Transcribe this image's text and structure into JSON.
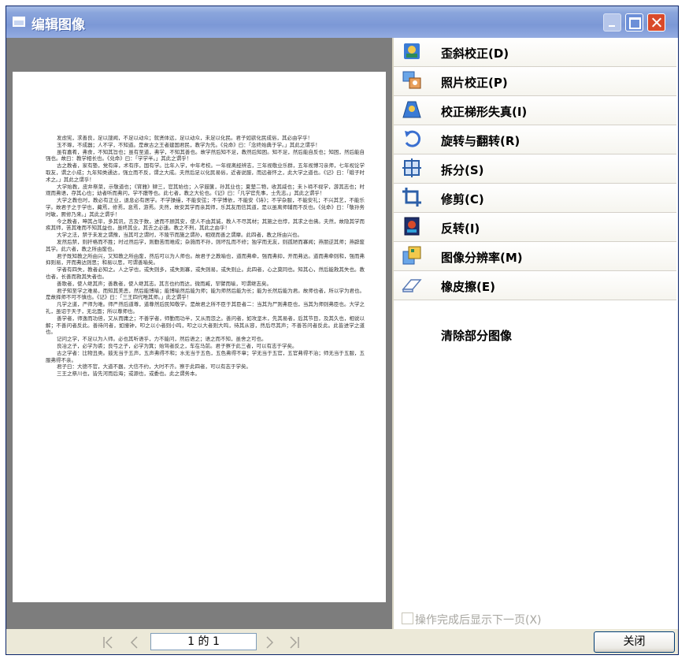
{
  "window": {
    "title": "编辑图像"
  },
  "document_text": [
    "发虑宪，求善良，足以謏闻，不足以动众；就贤体远，足以动众，未足以化民。君子如欲化民成俗，其必由学乎！",
    "玉不琢，不成器；人不学，不知道。是故古之王者建国君民，教学为先。《兑命》曰：「念终始典于学。」其此之谓乎！",
    "虽有嘉肴，弗食，不知其旨也；虽有至道，弗学，不知其善也。故学然后知不足，教然后知困。知不足，然后能自反也；知困，然后能自强也。故曰：教学相长也。《兑命》曰：「学学半。」其此之谓乎！",
    "古之教者，家有塾，党有庠，术有序，国有学。比年入学，中年考校。一年视离经辨志，三年视敬业乐群，五年视博习亲师，七年视论学取友，谓之小成；九年知类通达，强立而不反，谓之大成。夫然后足以化民易俗，近者说服，而远者怀之，此大学之道也。《记》曰：「蛾子时术之。」其此之谓乎！",
    "大学始教，皮弁祭菜，示敬道也；《宵雅》肄三，官其始也；入学鼓箧，孙其业也；夏楚二物，收其威也；未卜禘不视学，游其志也；时观而弗语，存其心也；幼者听而弗问，学不躐等也。此七者，教之大伦也。《记》曰：「凡学官先事，士先志。」其此之谓乎！",
    "大学之教也时，教必有正业，退息必有居学。不学操缦，不能安弦；不学博依，不能安《诗》；不学杂服，不能安礼；不兴其艺，不能乐学。故君子之于学也，藏焉，修焉，息焉，游焉。夫然，故安其学而亲其师，乐其友而信其道，是以虽离师辅而不反也。《兑命》曰：「敬孙务时敏，厥修乃来。」其此之谓乎！",
    "今之教者，呻其占毕，多其讯，言及于数，进而不顾其安，使人不由其诚，教人不尽其材；其施之也悖，其求之也佛。夫然，故隐其学而疾其师，苦其难而不知其益也，虽终其业，其去之必速。教之不刑，其此之由乎！",
    "大学之法，禁于未发之谓豫，当其可之谓时，不陵节而施之谓孙，相观而善之谓摩。此四者，教之所由兴也。",
    "发然后禁，则扞格而不胜；时过然后学，则勤苦而难成；杂施而不孙，则坏乱而不修；独学而无友，则孤陋而寡闻；燕朋逆其师；燕辟废其学。此六者，教之所由废也。",
    "君子既知教之所由兴，又知教之所由废，然后可以为人师也。故君子之教喻也，道而弗牵，强而弗抑，开而弗达。道而弗牵则和，强而弗抑则易，开而弗达则思；和易以思，可谓善喻矣。",
    "学者有四失，教者必知之。人之学也，或失则多，或失则寡，或失则易，或失则止。此四者，心之莫同也。知其心，然后能救其失也。教也者，长善而救其失者也。",
    "善歌者，使人继其声；善教者，使人继其志。其言也约而达，微而臧，罕譬而喻，可谓继志矣。",
    "君子知至学之难易，而知其美恶，然后能博喻；能博喻然后能为师；能为师然后能为长；能为长然后能为君。故师也者，所以学为君也。是故择师不可不慎也。《记》曰：「三王四代唯其师。」此之谓乎！",
    "凡学之道，严师为难。师严然后道尊，道尊然后民知敬学。是故君之所不臣于其臣者二：当其为尸则弗臣也，当其为师则弗臣也。大学之礼，虽诏于天子，无北面；所以尊师也。",
    "善学者，师逸而功倍，又从而庸之；不善学者，师勤而功半，又从而怨之。善问者，如攻坚木，先其易者，后其节目，及其久也，相说以解；不善问者反此。善待问者，如撞钟，叩之以小者则小鸣，叩之以大者则大鸣，待其从容，然后尽其声；不善答问者反此。此皆进学之道也。",
    "记问之学，不足以为人师。必也其听语乎，力不能问，然后语之；语之而不知，虽舍之可也。",
    "良冶之子，必学为裘；良弓之子，必学为箕；始驾者反之，车在马前。君子察于此三者，可以有志于学矣。",
    "古之学者：比物丑类。鼓无当于五声，五声弗得不和；水无当于五色，五色弗得不章；学无当于五官，五官弗得不治；师无当于五服，五服弗得不亲。",
    "君子曰：大德不官，大道不器，大信不约，大时不齐。察于此四者，可以有志于学矣。",
    "三王之祭川也，皆先河而后海；或源也，或委也。此之谓务本。"
  ],
  "menu": {
    "items": [
      {
        "label": "歪斜校正(D)",
        "icon": "deskew-icon"
      },
      {
        "label": "照片校正(P)",
        "icon": "photo-correct-icon"
      },
      {
        "label": "校正梯形失真(I)",
        "icon": "keystone-icon"
      },
      {
        "label": "旋转与翻转(R)",
        "icon": "rotate-icon"
      },
      {
        "label": "拆分(S)",
        "icon": "split-icon"
      },
      {
        "label": "修剪(C)",
        "icon": "crop-icon"
      },
      {
        "label": "反转(I)",
        "icon": "invert-icon"
      },
      {
        "label": "图像分辨率(M)",
        "icon": "resolution-icon"
      },
      {
        "label": "橡皮擦(E)",
        "icon": "eraser-icon"
      }
    ],
    "plain_item": "清除部分图像"
  },
  "options": {
    "next_page_checkbox_label": "操作完成后显示下一页(X)",
    "next_page_checked": false
  },
  "navigation": {
    "page_indicator": "1 的 1"
  },
  "buttons": {
    "close_label": "关闭"
  }
}
